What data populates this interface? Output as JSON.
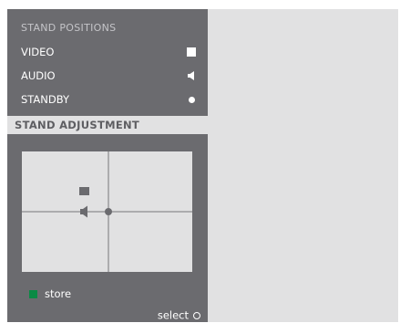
{
  "menu": {
    "section_title": "STAND POSITIONS",
    "items": [
      {
        "label": "VIDEO",
        "icon": "square-icon"
      },
      {
        "label": "AUDIO",
        "icon": "speaker-icon"
      },
      {
        "label": "STANDBY",
        "icon": "dot-icon"
      }
    ],
    "adjustment_label": "STAND ADJUSTMENT"
  },
  "footer": {
    "store_label": "store",
    "store_color": "#0a8a45",
    "select_label": "select"
  },
  "colors": {
    "menu_bg": "#6b6b6f",
    "panel_bg": "#e1e1e2",
    "highlight_bg": "#e1e1e2",
    "grid_line": "#76767a"
  }
}
